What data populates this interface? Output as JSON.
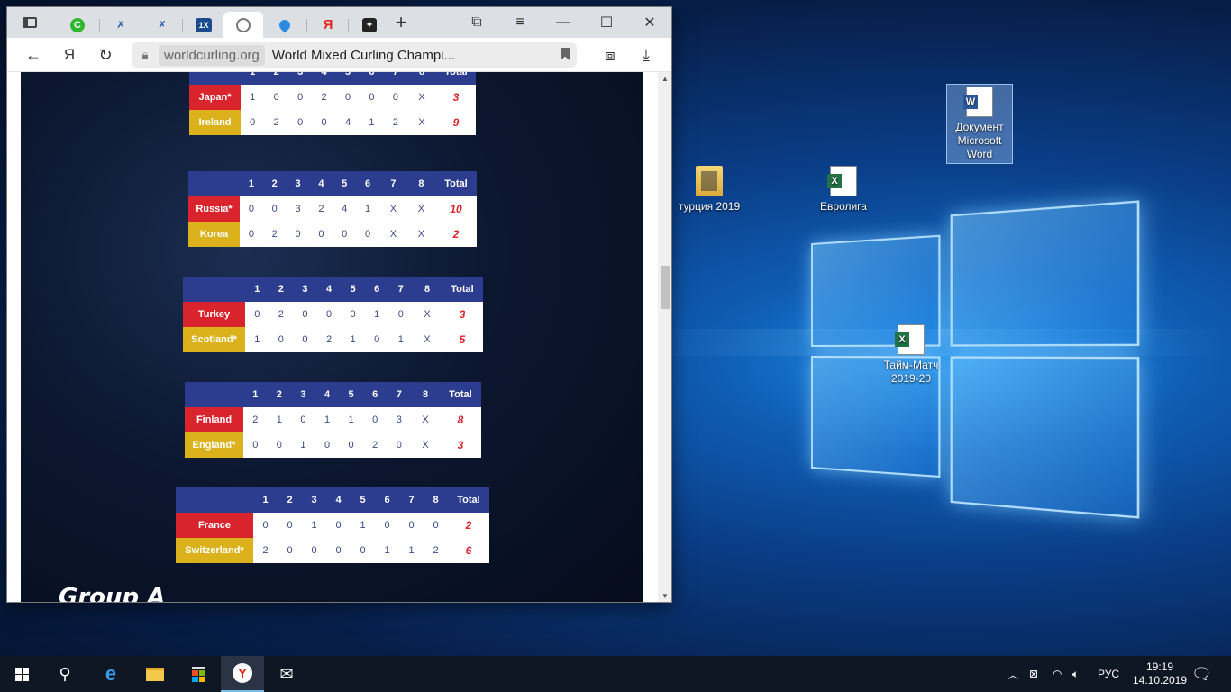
{
  "browser": {
    "tabs": [
      {
        "name": "tab-1",
        "icon": "chat-icon"
      },
      {
        "name": "tab-2",
        "icon": "athlete-icon"
      },
      {
        "name": "tab-3",
        "icon": "athlete-icon"
      },
      {
        "name": "tab-4",
        "icon": "1xbet-icon"
      },
      {
        "name": "tab-5",
        "icon": "worldcurling-icon",
        "active": true
      },
      {
        "name": "tab-6",
        "icon": "drop-icon"
      },
      {
        "name": "tab-7",
        "icon": "yandex-icon"
      },
      {
        "name": "tab-8",
        "icon": "plus-square-icon"
      }
    ],
    "url_domain": "worldcurling.org",
    "page_title": "World Mixed Curling Champi...",
    "yandex_label": "Я"
  },
  "header_cols": [
    "1",
    "2",
    "3",
    "4",
    "5",
    "6",
    "7",
    "8",
    "Total"
  ],
  "games": [
    {
      "team1": "Japan*",
      "scores1": [
        "1",
        "0",
        "0",
        "2",
        "0",
        "0",
        "0",
        "X"
      ],
      "total1": "3",
      "team2": "Ireland",
      "scores2": [
        "0",
        "2",
        "0",
        "0",
        "4",
        "1",
        "2",
        "X"
      ],
      "total2": "9"
    },
    {
      "team1": "Russia*",
      "scores1": [
        "0",
        "0",
        "3",
        "2",
        "4",
        "1",
        "X",
        "X"
      ],
      "total1": "10",
      "team2": "Korea",
      "scores2": [
        "0",
        "2",
        "0",
        "0",
        "0",
        "0",
        "X",
        "X"
      ],
      "total2": "2"
    },
    {
      "team1": "Turkey",
      "scores1": [
        "0",
        "2",
        "0",
        "0",
        "0",
        "1",
        "0",
        "X"
      ],
      "total1": "3",
      "team2": "Scotland*",
      "scores2": [
        "1",
        "0",
        "0",
        "2",
        "1",
        "0",
        "1",
        "X"
      ],
      "total2": "5"
    },
    {
      "team1": "Finland",
      "scores1": [
        "2",
        "1",
        "0",
        "1",
        "1",
        "0",
        "3",
        "X"
      ],
      "total1": "8",
      "team2": "England*",
      "scores2": [
        "0",
        "0",
        "1",
        "0",
        "0",
        "2",
        "0",
        "X"
      ],
      "total2": "3"
    },
    {
      "team1": "France",
      "scores1": [
        "0",
        "0",
        "1",
        "0",
        "1",
        "0",
        "0",
        "0"
      ],
      "total1": "2",
      "team2": "Switzerland*",
      "scores2": [
        "2",
        "0",
        "0",
        "0",
        "0",
        "1",
        "1",
        "2"
      ],
      "total2": "6"
    }
  ],
  "section_heading": "Group A",
  "desktop_icons": [
    {
      "label": "Документ Microsoft Word",
      "type": "word-doc"
    },
    {
      "label": "турция 2019",
      "type": "folder"
    },
    {
      "label": "Евролига",
      "type": "excel"
    },
    {
      "label": "Тайм-Матч 2019-20",
      "type": "excel"
    }
  ],
  "taskbar": {
    "language": "РУС",
    "time": "19:19",
    "date": "14.10.2019"
  }
}
